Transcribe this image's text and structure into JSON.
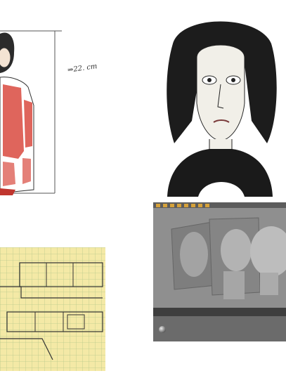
{
  "tiles": {
    "character_sketch": {
      "note": "⇒22. cm"
    },
    "portrait_drawing": {},
    "kitchen_blueprint": {},
    "cad_viewport": {}
  }
}
